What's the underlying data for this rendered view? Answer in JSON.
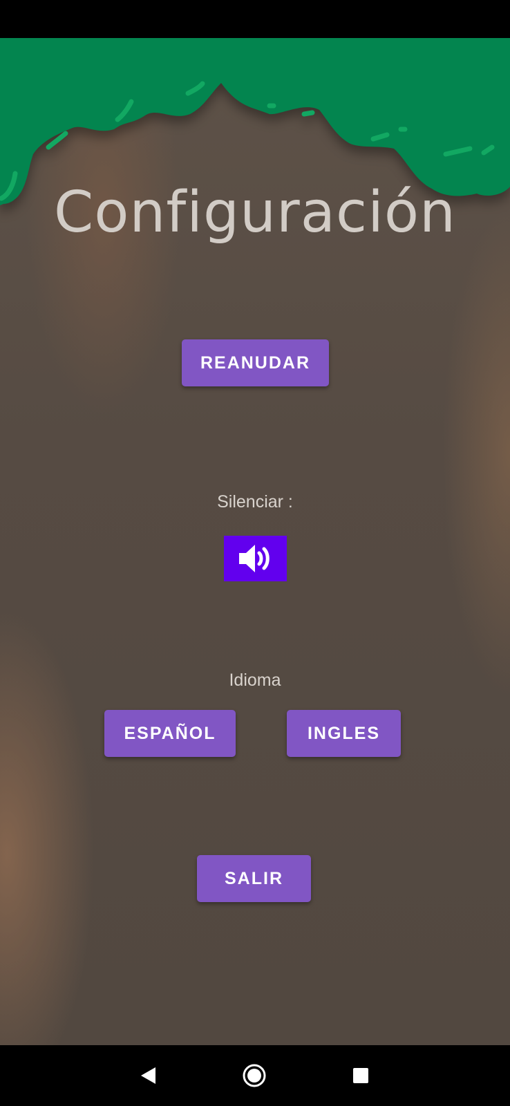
{
  "screen": {
    "title": "Configuración",
    "background_color": "#564b43",
    "canopy_color": "#03854f"
  },
  "buttons": {
    "resume_label": "REANUDAR",
    "spanish_label": "ESPAÑOL",
    "english_label": "INGLES",
    "exit_label": "SALIR",
    "color": "#8156c4"
  },
  "mute": {
    "label": "Silenciar :",
    "icon": "volume-up-icon",
    "button_color": "#6200ee"
  },
  "language": {
    "label": "Idioma"
  },
  "navigation": {
    "back_icon": "back-triangle-icon",
    "home_icon": "home-circle-icon",
    "recents_icon": "recents-square-icon"
  }
}
